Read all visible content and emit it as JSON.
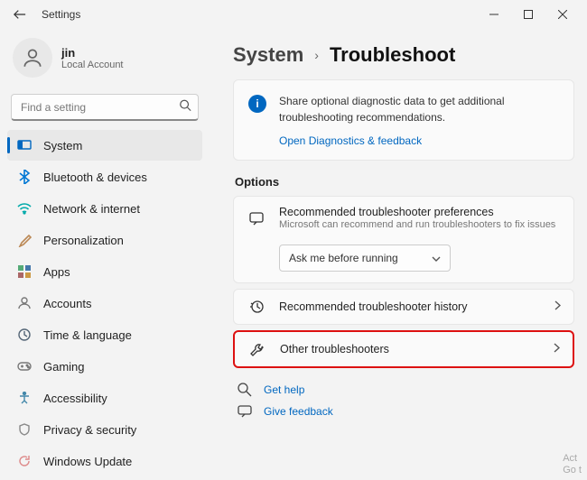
{
  "window": {
    "title": "Settings"
  },
  "user": {
    "name": "jin",
    "subtitle": "Local Account"
  },
  "search": {
    "placeholder": "Find a setting"
  },
  "nav": [
    {
      "label": "System"
    },
    {
      "label": "Bluetooth & devices"
    },
    {
      "label": "Network & internet"
    },
    {
      "label": "Personalization"
    },
    {
      "label": "Apps"
    },
    {
      "label": "Accounts"
    },
    {
      "label": "Time & language"
    },
    {
      "label": "Gaming"
    },
    {
      "label": "Accessibility"
    },
    {
      "label": "Privacy & security"
    },
    {
      "label": "Windows Update"
    }
  ],
  "breadcrumb": {
    "parent": "System",
    "sep": "›",
    "current": "Troubleshoot"
  },
  "info": {
    "text": "Share optional diagnostic data to get additional troubleshooting recommendations.",
    "link": "Open Diagnostics & feedback"
  },
  "sections": {
    "options": "Options"
  },
  "prefs": {
    "title": "Recommended troubleshooter preferences",
    "sub": "Microsoft can recommend and run troubleshooters to fix issues",
    "dropdown": "Ask me before running"
  },
  "history": {
    "title": "Recommended troubleshooter history"
  },
  "other": {
    "title": "Other troubleshooters"
  },
  "footer": {
    "help": "Get help",
    "feedback": "Give feedback"
  },
  "watermark": {
    "l1": "Act",
    "l2": "Go t"
  }
}
